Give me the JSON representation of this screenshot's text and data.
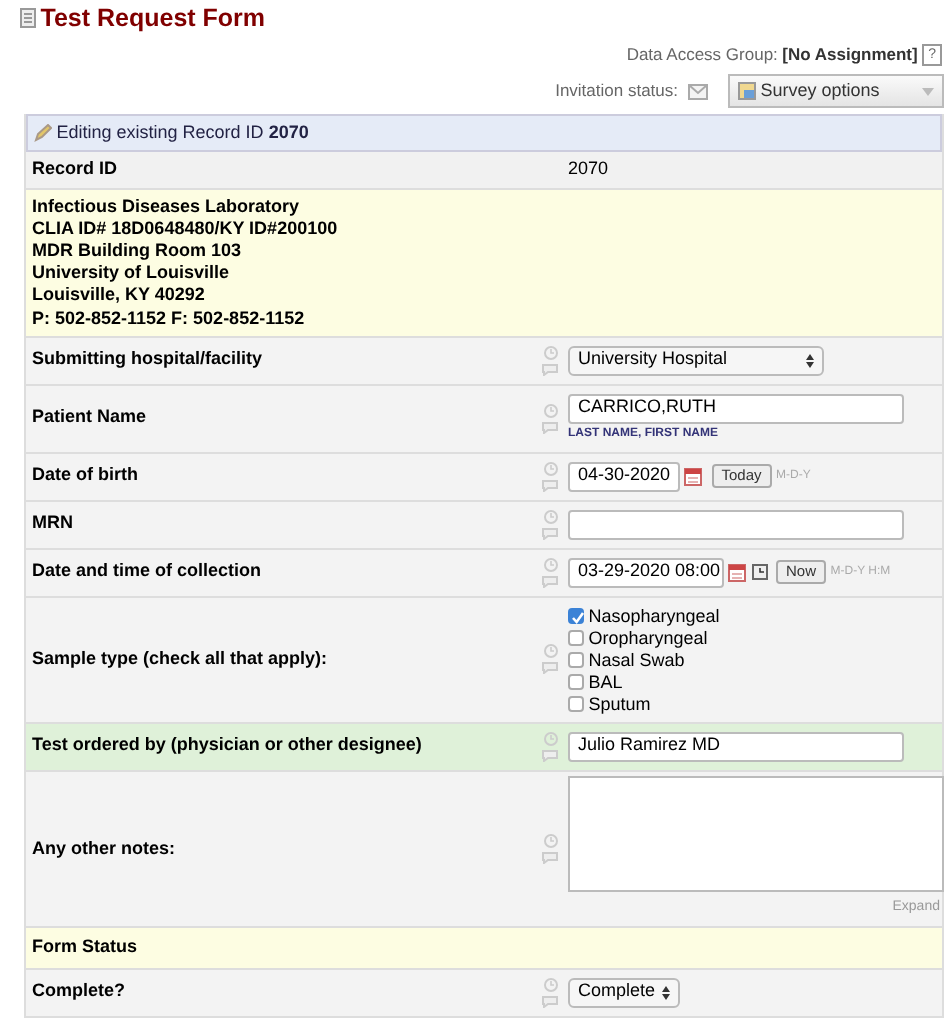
{
  "title": "Test Request Form",
  "data_access_group": {
    "label": "Data Access Group:",
    "value": "[No Assignment]",
    "help": "?"
  },
  "invitation": {
    "label": "Invitation status:"
  },
  "survey_options": {
    "label": "Survey options"
  },
  "editing": {
    "text": "Editing existing Record ID **2070**"
  },
  "record_id": {
    "label": "Record ID",
    "value": "2070"
  },
  "lab_info": [
    "Infectious Diseases Laboratory",
    "CLIA ID# 18D0648480/KY ID#200100",
    "MDR Building Room 103",
    "University of Louisville",
    "Louisville, KY 40292",
    "P: 502-852-1152 F: 502-852-1152"
  ],
  "fields": [
    {
      "kind": "select",
      "label": "Submitting hospital/facility",
      "value": "University Hospital",
      "focused": false
    },
    {
      "kind": "text",
      "label": "Patient Name",
      "value": "CARRICO,RUTH",
      "note": "LAST NAME, FIRST NAME",
      "focused": false
    },
    {
      "kind": "date",
      "label": "Date of birth",
      "value": "04-30-2020",
      "button": "Today",
      "format": "M-D-Y",
      "focused": false
    },
    {
      "kind": "text",
      "label": "MRN",
      "focused": false
    },
    {
      "kind": "datetime",
      "label": "Date and time of collection",
      "value": "03-29-2020 08:00",
      "button": "Now",
      "format": "M-D-Y H:M",
      "focused": false
    },
    {
      "kind": "checkboxes",
      "label": "Sample type (check all that apply):",
      "focused": false,
      "options": [
        {
          "label": "Nasopharyngeal",
          "checked": true
        },
        {
          "label": "Oropharyngeal",
          "checked": false
        },
        {
          "label": "Nasal Swab",
          "checked": false
        },
        {
          "label": "BAL",
          "checked": false
        },
        {
          "label": "Sputum",
          "checked": false
        }
      ]
    },
    {
      "kind": "text",
      "label": "Test ordered by (physician or other designee)",
      "value": "Julio Ramirez MD",
      "focused": true
    },
    {
      "kind": "textarea",
      "label": "Any other notes:",
      "expand": "Expand",
      "focused": false
    }
  ],
  "form_status": {
    "heading": "Form Status",
    "label": "Complete?",
    "value": "Complete"
  }
}
